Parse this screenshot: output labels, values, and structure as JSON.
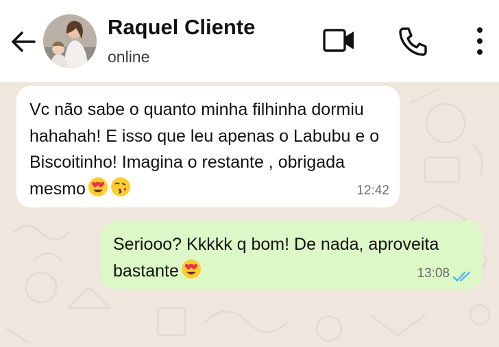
{
  "header": {
    "contact_name": "Raquel Cliente",
    "status": "online",
    "icons": [
      "back-arrow-icon",
      "video-call-icon",
      "phone-icon",
      "more-options-icon"
    ]
  },
  "messages": [
    {
      "direction": "incoming",
      "text": "Vc não sabe o quanto minha filhinha dormiu hahahah! E isso que leu apenas o Labubu e o Biscoitinho! Imagina o restante , obrigada mesmo",
      "emojis": [
        "😍",
        "😘"
      ],
      "time": "12:42"
    },
    {
      "direction": "outgoing",
      "text": "Seriooo? Kkkkk q bom! De nada, aproveita bastante",
      "emojis": [
        "😍"
      ],
      "time": "13:08",
      "status": "read"
    }
  ],
  "colors": {
    "header_bg": "#ffffff",
    "wallpaper_bg": "#efe7de",
    "incoming_bubble": "#ffffff",
    "outgoing_bubble": "#dcf8c6",
    "read_ticks": "#4fb6ec"
  }
}
